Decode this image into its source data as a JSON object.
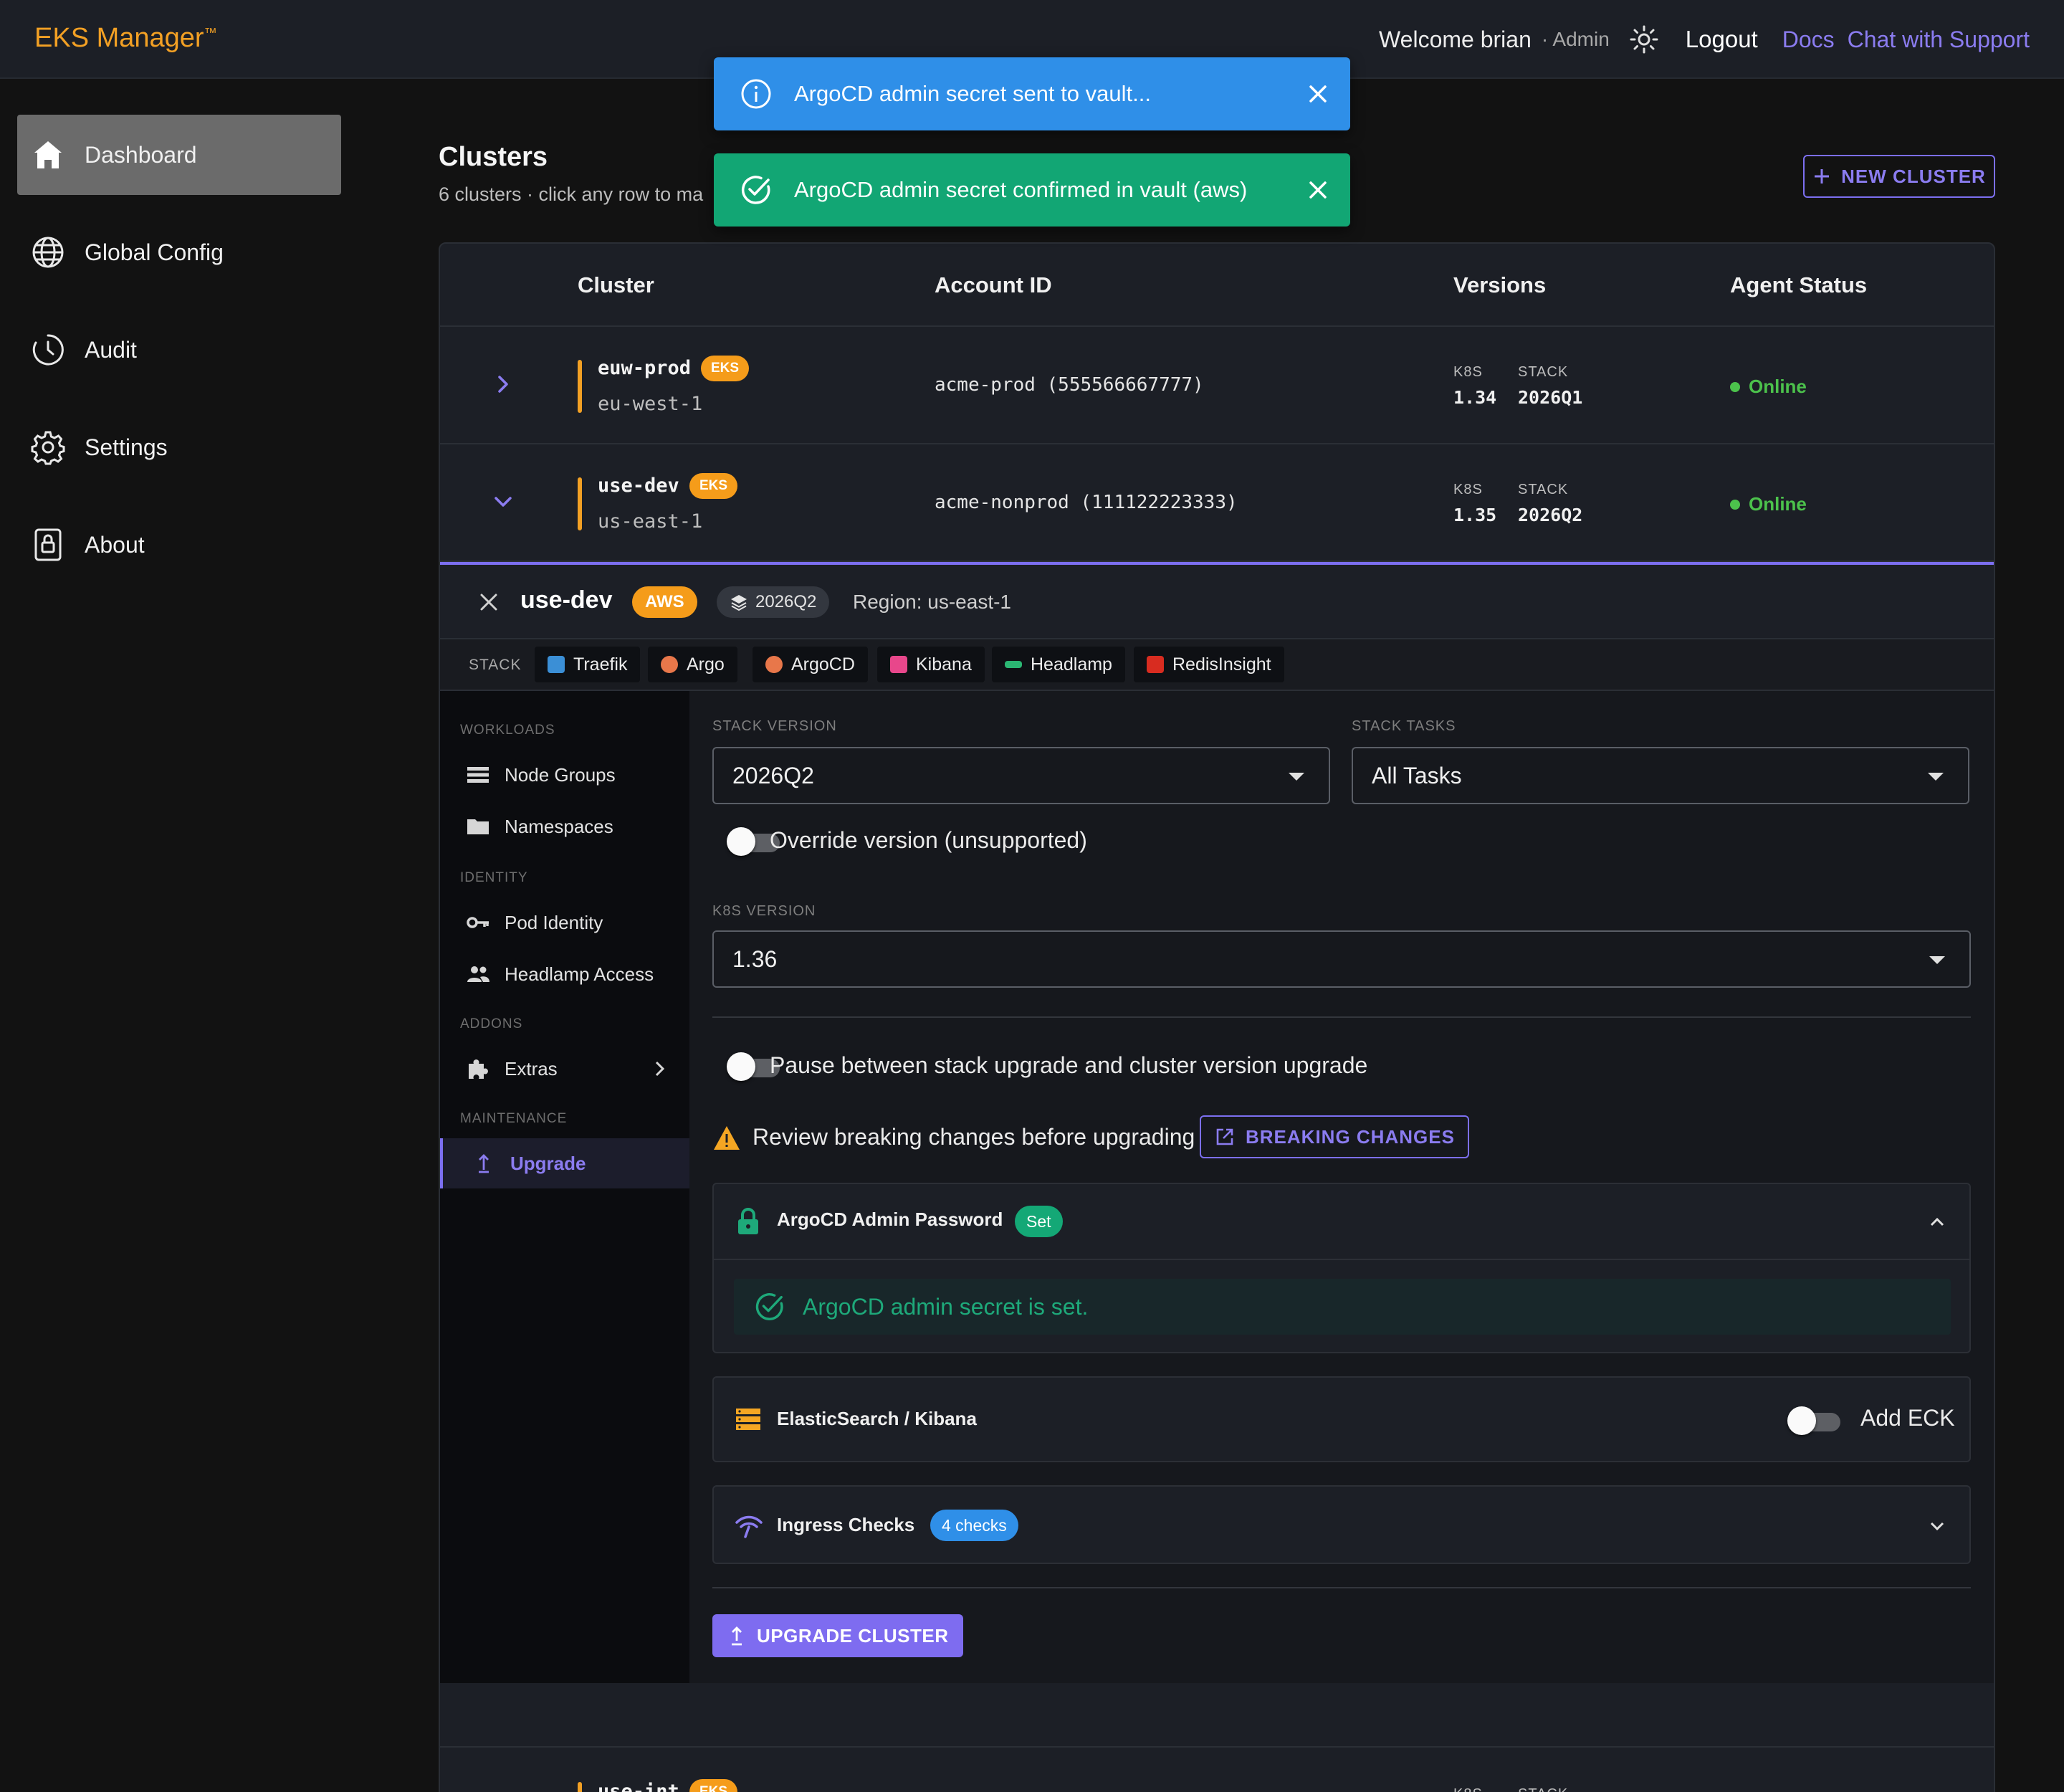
{
  "app": {
    "brand": "EKS Manager",
    "brand_mark": "™"
  },
  "topbar": {
    "welcome": "Welcome brian",
    "role": "· Admin",
    "logout": "Logout",
    "docs": "Docs",
    "support": "Chat with Support"
  },
  "sidebar": {
    "items": [
      {
        "label": "Dashboard",
        "icon": "home-icon",
        "active": true
      },
      {
        "label": "Global Config",
        "icon": "globe-icon"
      },
      {
        "label": "Audit",
        "icon": "clock-icon"
      },
      {
        "label": "Settings",
        "icon": "gear-icon"
      },
      {
        "label": "About",
        "icon": "lock-icon"
      }
    ]
  },
  "toasts": [
    {
      "type": "info",
      "message": "ArgoCD admin secret sent to vault..."
    },
    {
      "type": "success",
      "message": "ArgoCD admin secret confirmed in vault (aws)"
    }
  ],
  "main": {
    "title": "Clusters",
    "subtitle": "6 clusters · click any row to ma",
    "new_cluster": "NEW CLUSTER"
  },
  "table": {
    "headers": {
      "cluster": "Cluster",
      "account": "Account ID",
      "versions": "Versions",
      "status": "Agent Status"
    },
    "ver_k8s_label": "K8S",
    "ver_stack_label": "STACK",
    "rows": [
      {
        "name": "euw-prod",
        "badge": "EKS",
        "region": "eu-west-1",
        "account": "acme-prod (555566667777)",
        "k8s": "1.34",
        "stack": "2026Q1",
        "status": "Online"
      },
      {
        "name": "use-dev",
        "badge": "EKS",
        "region": "us-east-1",
        "account": "acme-nonprod (111122223333)",
        "k8s": "1.35",
        "stack": "2026Q2",
        "status": "Online"
      }
    ],
    "next_row": {
      "name": "use-int",
      "badge": "EKS"
    }
  },
  "detail": {
    "name": "use-dev",
    "provider": "AWS",
    "stack": "2026Q2",
    "region": "Region: us-east-1",
    "stack_label": "STACK",
    "chips": [
      {
        "label": "Traefik",
        "color": "#3b8fd6"
      },
      {
        "label": "Argo",
        "color": "#e8774a"
      },
      {
        "label": "ArgoCD",
        "color": "#e8774a"
      },
      {
        "label": "Kibana",
        "color": "#e8478b"
      },
      {
        "label": "Headlamp",
        "color": "#2bb673"
      },
      {
        "label": "RedisInsight",
        "color": "#d82c20"
      }
    ],
    "nav": {
      "workloads": "WORKLOADS",
      "node_groups": "Node Groups",
      "namespaces": "Namespaces",
      "identity": "IDENTITY",
      "pod_identity": "Pod Identity",
      "headlamp_access": "Headlamp Access",
      "addons": "ADDONS",
      "extras": "Extras",
      "maintenance": "MAINTENANCE",
      "upgrade": "Upgrade"
    },
    "form": {
      "stack_version_label": "STACK VERSION",
      "stack_version": "2026Q2",
      "stack_tasks_label": "STACK TASKS",
      "stack_tasks": "All Tasks",
      "override_label": "Override version (unsupported)",
      "k8s_version_label": "K8S VERSION",
      "k8s_version": "1.36",
      "pause_label": "Pause between stack upgrade and cluster version upgrade",
      "warning": "Review breaking changes before upgrading",
      "breaking_changes": "BREAKING CHANGES",
      "argocd_title": "ArgoCD Admin Password",
      "argocd_badge": "Set",
      "argocd_msg": "ArgoCD admin secret is set.",
      "eck_title": "ElasticSearch / Kibana",
      "eck_toggle": "Add ECK",
      "ingress_title": "Ingress Checks",
      "ingress_badge": "4 checks",
      "upgrade_button": "UPGRADE CLUSTER"
    }
  },
  "colors": {
    "accent": "#7c6ff0",
    "brand": "#f2a024",
    "success": "#12a674",
    "info": "#2f8fe8",
    "online": "#4cc24c"
  }
}
